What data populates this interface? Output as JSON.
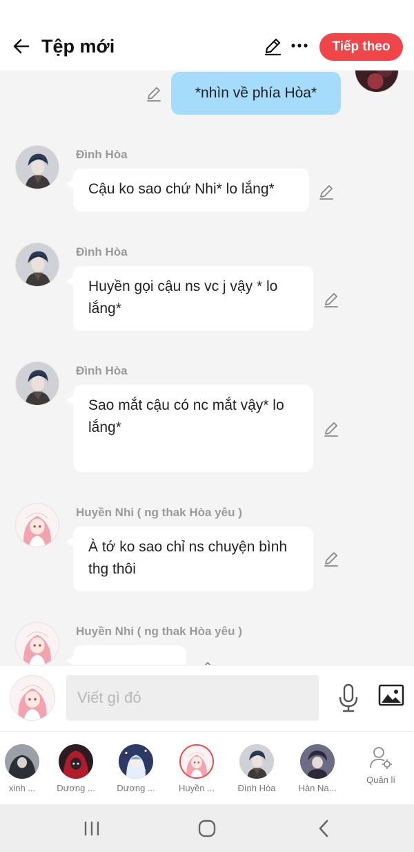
{
  "header": {
    "title": "Tệp mới",
    "next_label": "Tiếp theo",
    "back_icon": "arrow-left-icon",
    "edit_icon": "pencil-icon",
    "more_icon": "more-horizontal-icon",
    "accent": "#f0464a"
  },
  "messages": {
    "self": {
      "text": "*nhìn về phía Hòa*"
    },
    "m1": {
      "sender": "Đình Hòa",
      "text": "Cậu ko sao chứ Nhi* lo lắng*"
    },
    "m2": {
      "sender": "Đình Hòa",
      "text": "Huyền gọi cậu ns vc j vậy * lo lắng*"
    },
    "m3": {
      "sender": "Đình Hòa",
      "text": "Sao mắt cậu có nc mắt vậy* lo lắng*"
    },
    "m4": {
      "sender": "Huyền Nhi ( ng thak Hòa yêu )",
      "text": "À tớ ko sao chỉ ns chuyện bình thg thôi"
    },
    "m5": {
      "sender": "Huyền Nhi ( ng thak Hòa yêu )",
      "text": ""
    }
  },
  "composer": {
    "placeholder": "Viết gì đó",
    "mic_icon": "microphone-icon",
    "image_icon": "image-icon"
  },
  "characters": [
    {
      "label": "xinh ..."
    },
    {
      "label": "Dương ..."
    },
    {
      "label": "Dương ..."
    },
    {
      "label": "Huyền ..."
    },
    {
      "label": "Đình Hòa"
    },
    {
      "label": "Hàn Na..."
    },
    {
      "label": "Quản lí",
      "icon": "manage-user-icon"
    }
  ],
  "nav": {
    "recent_icon": "recent-apps-icon",
    "home_icon": "home-icon",
    "back_icon": "back-chevron-icon"
  }
}
